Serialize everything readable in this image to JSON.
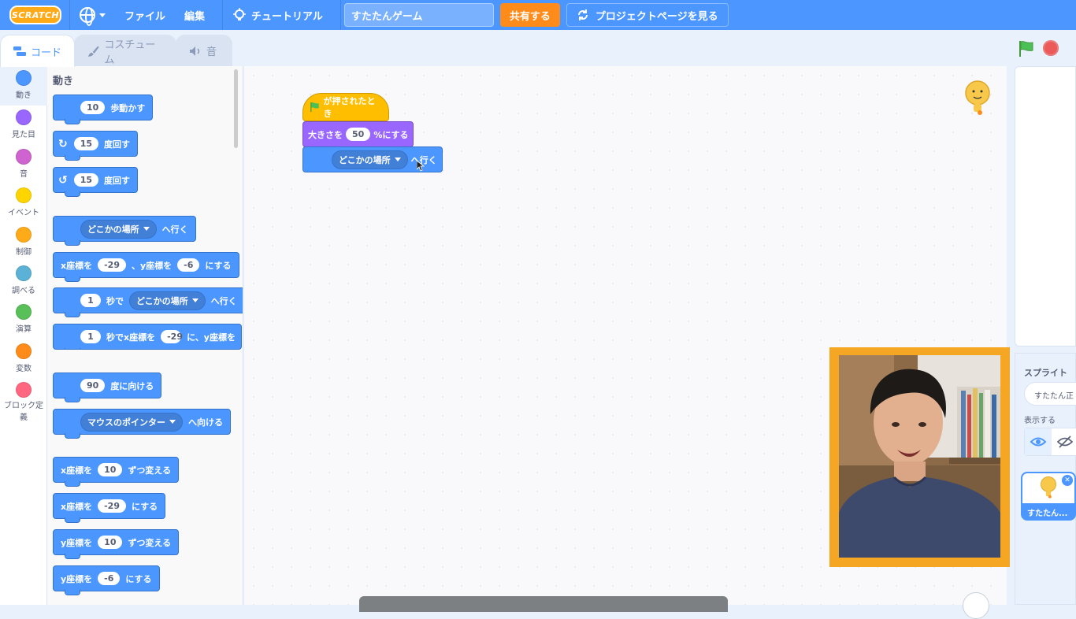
{
  "menubar": {
    "logo": "SCRATCH",
    "file": "ファイル",
    "edit": "編集",
    "tutorials": "チュートリアル",
    "project_title": "すたたんゲーム",
    "share": "共有する",
    "see_project_page": "プロジェクトページを見る"
  },
  "tabs": {
    "code": "コード",
    "costumes": "コスチューム",
    "sounds": "音"
  },
  "categories": [
    {
      "label": "動き",
      "color": "#4c97ff"
    },
    {
      "label": "見た目",
      "color": "#9966ff"
    },
    {
      "label": "音",
      "color": "#cf63cf"
    },
    {
      "label": "イベント",
      "color": "#ffd500"
    },
    {
      "label": "制御",
      "color": "#ffab19"
    },
    {
      "label": "調べる",
      "color": "#5cb1d6"
    },
    {
      "label": "演算",
      "color": "#59c059"
    },
    {
      "label": "変数",
      "color": "#ff8c1a"
    },
    {
      "label": "ブロック定義",
      "color": "#ff6680"
    }
  ],
  "palette": {
    "heading": "動き",
    "move": {
      "value": "10",
      "label": "歩動かす"
    },
    "turn_right": {
      "value": "15",
      "label": "度回す"
    },
    "turn_left": {
      "value": "15",
      "label": "度回す"
    },
    "goto": {
      "dropdown": "どこかの場所",
      "label": "へ行く"
    },
    "goto_xy": {
      "x_label": "x座標を",
      "x": "-29",
      "y_label": "、y座標を",
      "y": "-6",
      "suffix": "にする"
    },
    "glide_to": {
      "secs": "1",
      "label1": "秒で",
      "dropdown": "どこかの場所",
      "label2": "へ行く"
    },
    "glide_xy": {
      "secs": "1",
      "label1": "秒でx座標を",
      "x": "-29",
      "label2": "に、y座標を"
    },
    "point_dir": {
      "value": "90",
      "label": "度に向ける"
    },
    "point_towards": {
      "dropdown": "マウスのポインター",
      "label": "へ向ける"
    },
    "change_x": {
      "label1": "x座標を",
      "value": "10",
      "label2": "ずつ変える"
    },
    "set_x": {
      "label1": "x座標を",
      "value": "-29",
      "label2": "にする"
    },
    "change_y": {
      "label1": "y座標を",
      "value": "10",
      "label2": "ずつ変える"
    },
    "set_y": {
      "label1": "y座標を",
      "value": "-6",
      "label2": "にする"
    }
  },
  "script": {
    "hat": "が押されたとき",
    "size_label": "大きさを",
    "size_value": "50",
    "size_suffix": "%にする",
    "goto_dropdown": "どこかの場所",
    "goto_label": "へ行く"
  },
  "sprite_panel": {
    "heading": "スプライト",
    "name_value": "すたたん正",
    "show_label": "表示する",
    "thumb_label": "すたたん..."
  }
}
